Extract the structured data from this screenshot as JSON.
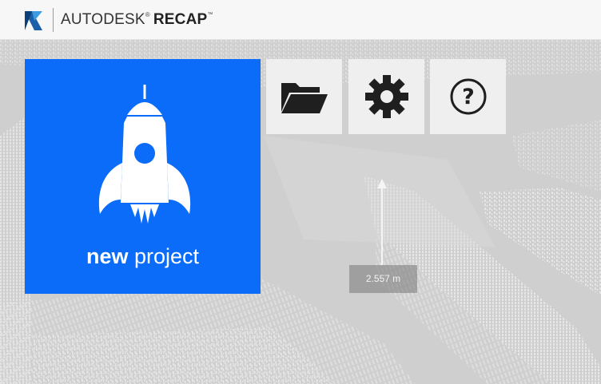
{
  "titlebar": {
    "brand_light": "AUTODESK",
    "brand_reg": "®",
    "brand_bold": "RECAP",
    "brand_tm": "™",
    "logo_icon": "recap-logo-icon"
  },
  "tiles": {
    "new_project": {
      "label_strong": "new",
      "label_rest": "project",
      "icon": "rocket-icon",
      "color": "#0a6cf8"
    },
    "open": {
      "icon": "folder-open-icon"
    },
    "settings": {
      "icon": "gear-icon"
    },
    "help": {
      "icon": "help-icon",
      "glyph": "?"
    }
  },
  "viewport": {
    "measurement": "2.557 m"
  },
  "colors": {
    "accent": "#0a6cf8",
    "tile_bg": "#efefef",
    "viewport_bg": "#d3d3d3"
  }
}
